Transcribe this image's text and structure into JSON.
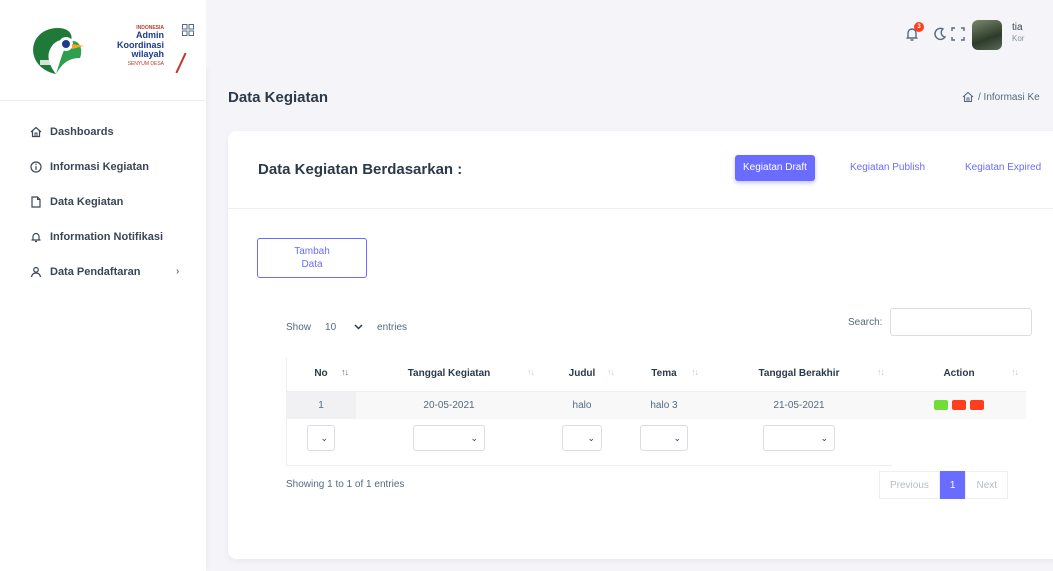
{
  "sidebar": {
    "logo": {
      "top": "INDONESIA",
      "title_line1": "Admin",
      "title_line2": "Koordinasi",
      "title_line3": "wilayah",
      "bottom": "SENYUM DESA"
    },
    "items": [
      {
        "label": "Dashboards",
        "icon": "home-icon"
      },
      {
        "label": "Informasi Kegiatan",
        "icon": "info-icon"
      },
      {
        "label": "Data Kegiatan",
        "icon": "file-icon"
      },
      {
        "label": "Information Notifikasi",
        "icon": "bell-icon"
      },
      {
        "label": "Data Pendaftaran",
        "icon": "user-icon",
        "has_submenu": true
      }
    ]
  },
  "navbar": {
    "notification_count": "3",
    "user_name": "tia",
    "user_role": "Kor"
  },
  "page": {
    "title": "Data Kegiatan",
    "breadcrumb": "/ Informasi Ke"
  },
  "card": {
    "title": "Data Kegiatan Berdasarkan :",
    "tabs": [
      "Kegiatan Draft",
      "Kegiatan Publish",
      "Kegiatan Expired"
    ],
    "active_tab": "Kegiatan Draft",
    "add_button_line1": "Tambah",
    "add_button_line2": "Data"
  },
  "table": {
    "show_label": "Show",
    "entries_value": "10",
    "entries_label": "entries",
    "search_label": "Search:",
    "columns": [
      "No",
      "Tanggal Kegiatan",
      "Judul",
      "Tema",
      "Tanggal Berakhir",
      "Action"
    ],
    "rows": [
      {
        "no": "1",
        "tanggal": "20-05-2021",
        "judul": "halo",
        "tema": "halo 3",
        "berakhir": "21-05-2021"
      }
    ],
    "info": "Showing 1 to 1 of 1 entries",
    "pager": {
      "previous": "Previous",
      "current": "1",
      "next": "Next"
    }
  },
  "colors": {
    "primary": "#696cff",
    "edit": "#71dd37",
    "view": "#ff3e1d",
    "delete": "#ff3e1d"
  }
}
